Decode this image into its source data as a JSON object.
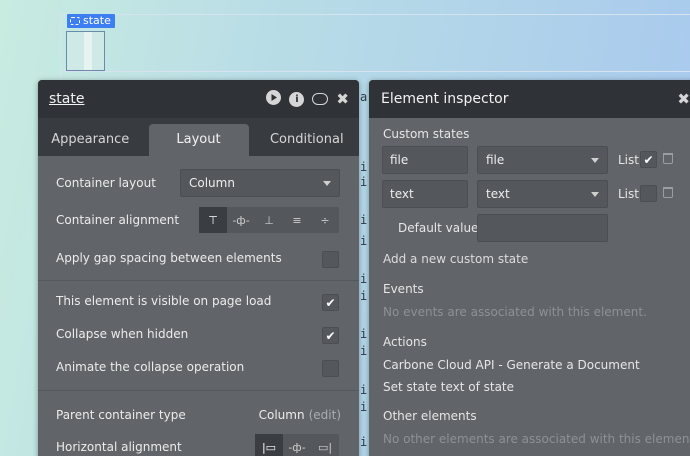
{
  "canvas": {
    "state_tag": "state"
  },
  "behind_text": [
    "i",
    "i",
    "i",
    "i",
    "i",
    "i",
    "i",
    "i",
    "i",
    "i",
    "i"
  ],
  "behind_a": "a",
  "property_editor": {
    "title": "state",
    "icons": [
      "play-icon",
      "info-icon",
      "comment-icon",
      "close-icon"
    ],
    "tabs": [
      "Appearance",
      "Layout",
      "Conditional"
    ],
    "active_tab": "Layout",
    "container_layout_label": "Container layout",
    "container_layout_value": "Column",
    "container_alignment_label": "Container alignment",
    "gap_spacing_label": "Apply gap spacing between elements",
    "visible_label": "This element is visible on page load",
    "visible_checked": true,
    "collapse_label": "Collapse when hidden",
    "collapse_checked": true,
    "animate_label": "Animate the collapse operation",
    "animate_checked": false,
    "parent_type_label": "Parent container type",
    "parent_type_value": "Column",
    "parent_type_edit": "(edit)",
    "horizontal_alignment_label": "Horizontal alignment"
  },
  "inspector": {
    "title": "Element inspector",
    "custom_states_heading": "Custom states",
    "states": [
      {
        "name": "file",
        "type": "file",
        "list_label": "List",
        "list_checked": true
      },
      {
        "name": "text",
        "type": "text",
        "list_label": "List",
        "list_checked": false
      }
    ],
    "default_value_label": "Default value",
    "default_value": "",
    "add_state_link": "Add a new custom state",
    "events_heading": "Events",
    "events_empty": "No events are associated with this element.",
    "actions_heading": "Actions",
    "actions": [
      "Carbone Cloud API - Generate a Document",
      "Set state text of state"
    ],
    "other_heading": "Other elements",
    "other_empty": "No other elements are associated with this element."
  }
}
